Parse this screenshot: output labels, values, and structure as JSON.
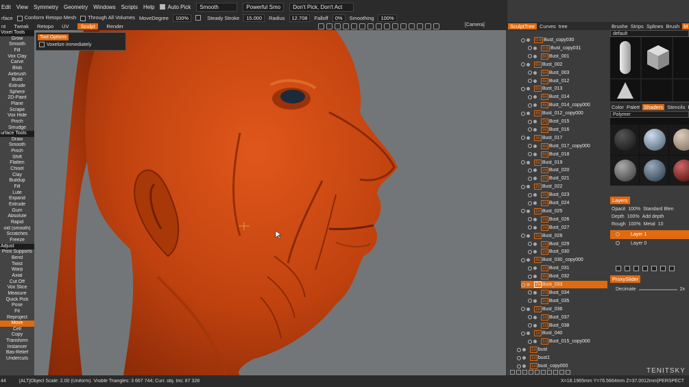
{
  "menu": {
    "items": [
      "Edit",
      "View",
      "Symmetry",
      "Geometry",
      "Windows",
      "Scripts",
      "Help"
    ],
    "auto_pick_label": "Auto Pick",
    "smooth_select": "Smooth",
    "powerful_smooth": "Powerful Smo",
    "dont_pick": "Don't Pick, Don't Act"
  },
  "toolbar": {
    "first": "rface",
    "conform_retopo": "Conform Retopo Mesh",
    "through_all": "Through All Volumes",
    "move_degree_label": "MoveDegree",
    "move_degree_value": "100%",
    "steady_stroke_label": "Steady Stroke",
    "steady_stroke_value": "15.000",
    "radius_label": "Radius",
    "radius_value": "12.708",
    "falloff_label": "Falloff",
    "falloff_value": "0%",
    "smoothing_label": "Smoothing",
    "smoothing_value": "100%"
  },
  "tabs": [
    "nt",
    "Tweak",
    "Retopo",
    "UV",
    "Sculpt",
    "Render"
  ],
  "active_tab": "Sculpt",
  "camera_label": "[Camera]",
  "left_tools": [
    {
      "label": "Voxel  Tools",
      "kind": "hdr"
    },
    {
      "label": "Grow"
    },
    {
      "label": "Smooth"
    },
    {
      "label": "Fill"
    },
    {
      "label": "Vox  Clay"
    },
    {
      "label": "Carve"
    },
    {
      "label": "Blob"
    },
    {
      "label": "Airbrush"
    },
    {
      "label": "Build"
    },
    {
      "label": "Extrude"
    },
    {
      "label": "Sphere"
    },
    {
      "label": "2D-Paint"
    },
    {
      "label": "Plane"
    },
    {
      "label": "Scrape"
    },
    {
      "label": "Vox  Hide"
    },
    {
      "label": "Pinch"
    },
    {
      "label": "Smudge"
    },
    {
      "label": "urface  Tools",
      "kind": "hdr"
    },
    {
      "label": "Draw"
    },
    {
      "label": "Smooth"
    },
    {
      "label": "Pinch"
    },
    {
      "label": "Shift"
    },
    {
      "label": "Flatten"
    },
    {
      "label": "Chisel"
    },
    {
      "label": "Clay"
    },
    {
      "label": "Buildup"
    },
    {
      "label": "Fill"
    },
    {
      "label": "Lute"
    },
    {
      "label": "Expand"
    },
    {
      "label": "Extrude"
    },
    {
      "label": "Gum"
    },
    {
      "label": "Absolute"
    },
    {
      "label": "Rapid"
    },
    {
      "label": "oid (smooth)"
    },
    {
      "label": "Scratches"
    },
    {
      "label": "Freeze"
    },
    {
      "label": "Adjust",
      "kind": "hdr"
    },
    {
      "label": "Print Supports"
    },
    {
      "label": "Bend"
    },
    {
      "label": "Twist"
    },
    {
      "label": "Warp"
    },
    {
      "label": "Axial"
    },
    {
      "label": "Cut  Off"
    },
    {
      "label": "Vox  Slice"
    },
    {
      "label": "Measure"
    },
    {
      "label": "Quick  Pick"
    },
    {
      "label": "Pose"
    },
    {
      "label": "Fit"
    },
    {
      "label": "Reproject"
    },
    {
      "label": "Move",
      "kind": "sel"
    },
    {
      "label": "Cell"
    },
    {
      "label": "Copy"
    },
    {
      "label": "Transform"
    },
    {
      "label": "Instancer"
    },
    {
      "label": "Bas-Relief"
    },
    {
      "label": "Undercuts"
    }
  ],
  "tool_options": {
    "title": "Tool Options",
    "voxelize": "Voxelize  immediately"
  },
  "status": {
    "left": "44",
    "main": "[ALT]Object  Scale: 2.00  (Uniform).  Visible  Triangles: 3  667  744;  Curr.  obj.  tris: 87  328",
    "right": "X=18.1965mm  Y=76.5664mm  Z=37.0012mm|PERSPECT"
  },
  "tree": {
    "tabs": [
      "SculptTree",
      "Curves",
      "tree"
    ],
    "rows": [
      {
        "badge": "0.6",
        "name": "Bust_copy030"
      },
      {
        "badge": "0.6",
        "name": "Bust_copy031"
      },
      {
        "badge": "6x",
        "name": "Bust_001"
      },
      {
        "badge": "6x",
        "name": "Bust_002"
      },
      {
        "badge": "6x",
        "name": "Bust_003"
      },
      {
        "badge": "4x",
        "name": "Bust_012"
      },
      {
        "badge": "6x",
        "name": "Bust_013"
      },
      {
        "badge": "6x",
        "name": "Bust_014"
      },
      {
        "badge": "4x",
        "name": "Bust_014_copy000"
      },
      {
        "badge": "4x",
        "name": "Bust_012_copy000"
      },
      {
        "badge": "2x",
        "name": "Bust_015"
      },
      {
        "badge": "3x",
        "name": "Bust_016"
      },
      {
        "badge": "3x",
        "name": "Bust_017"
      },
      {
        "badge": "4x",
        "name": "Bust_017_copy000"
      },
      {
        "badge": "6x",
        "name": "Bust_018"
      },
      {
        "badge": "6x",
        "name": "Bust_019"
      },
      {
        "badge": "2x",
        "name": "Bust_020"
      },
      {
        "badge": "2x",
        "name": "Bust_021"
      },
      {
        "badge": "2x",
        "name": "Bust_022"
      },
      {
        "badge": "2x",
        "name": "Bust_023"
      },
      {
        "badge": "2x",
        "name": "Bust_024"
      },
      {
        "badge": "2x",
        "name": "Bust_025"
      },
      {
        "badge": "2x",
        "name": "Bust_026"
      },
      {
        "badge": "2x",
        "name": "Bust_027"
      },
      {
        "badge": "2x",
        "name": "Bust_028"
      },
      {
        "badge": "2x",
        "name": "Bust_029"
      },
      {
        "badge": "2x",
        "name": "Bust_030"
      },
      {
        "badge": "4x",
        "name": "Bust_030_copy000"
      },
      {
        "badge": "2x",
        "name": "Bust_031"
      },
      {
        "badge": "4x",
        "name": "Bust_032"
      },
      {
        "badge": "2x",
        "name": "Bust_033",
        "selected": true
      },
      {
        "badge": "2x",
        "name": "Bust_034"
      },
      {
        "badge": "2x",
        "name": "Bust_035"
      },
      {
        "badge": "2x",
        "name": "Bust_036"
      },
      {
        "badge": "1x",
        "name": "Bust_037"
      },
      {
        "badge": "1x",
        "name": "Bust_038"
      },
      {
        "badge": "1x",
        "name": "Bust_040"
      },
      {
        "badge": "1x",
        "name": "Bust_015_copy000"
      },
      {
        "badge": "1x",
        "name": "bust",
        "plain": true
      },
      {
        "badge": "1x",
        "name": "bust1",
        "plain": true
      },
      {
        "badge": "1x",
        "name": "bust_copy000",
        "plain": true
      }
    ]
  },
  "right": {
    "brush_tabs": [
      "Brushe",
      "Strips",
      "Splines",
      "Brush",
      "M"
    ],
    "brush_preset": "default",
    "shader_tabs": [
      "Color",
      "Palett",
      "Shaders",
      "Stencils",
      "Pr"
    ],
    "shader_select": "Polymer",
    "layers_title": "Layers",
    "opacity_label": "Opacit",
    "opacity_value": "100%",
    "blend_mode": "Standard  Blen",
    "depth_label": "Depth",
    "depth_value": "100%",
    "depth_mode": "Add  depth",
    "rough_label": "Rough",
    "rough_value": "100%",
    "metal_label": "Metal",
    "metal_value": "10",
    "layer1": "Layer  1",
    "layer0": "Layer  0",
    "proxy_title": "ProxySlider",
    "decimate_label": "Decimate",
    "decimate_value": "2x"
  },
  "watermark": "TENITSKY",
  "colors": {
    "accent": "#e06a10",
    "clay": "#c1420f",
    "background": "#737678"
  }
}
